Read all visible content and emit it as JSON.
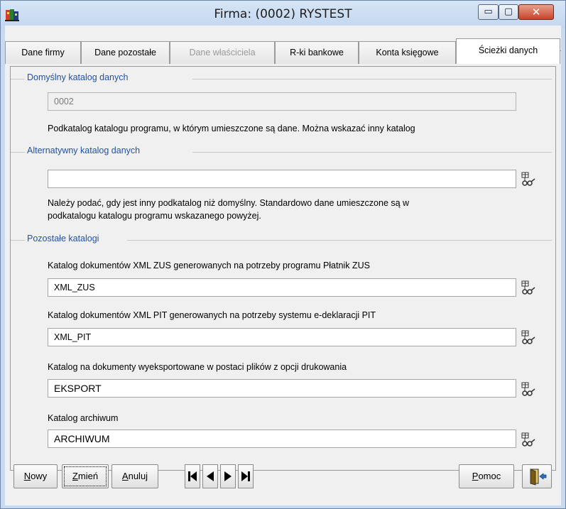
{
  "window": {
    "title": "Firma: (0002) RYSTEST",
    "min_glyph": "▭",
    "max_glyph": "▢",
    "close_glyph": "✕"
  },
  "tabs": [
    {
      "label": "Dane firmy",
      "state": "normal"
    },
    {
      "label": "Dane pozostałe",
      "state": "normal"
    },
    {
      "label": "Dane właściciela",
      "state": "disabled"
    },
    {
      "label": "R-ki bankowe",
      "state": "normal"
    },
    {
      "label": "Konta księgowe",
      "state": "normal"
    },
    {
      "label": "Ścieżki danych",
      "state": "active"
    }
  ],
  "default_catalog": {
    "legend": "Domyślny katalog danych",
    "value": "0002",
    "hint": "Podkatalog katalogu programu, w którym umieszczone są dane. Można wskazać inny katalog"
  },
  "alt_catalog": {
    "legend": "Alternatywny katalog danych",
    "value": "",
    "hint_line1": "Należy podać, gdy jest inny podkatalog niż domyślny. Standardowo dane umieszczone są w",
    "hint_line2": "podkatalogu katalogu programu wskazanego powyżej."
  },
  "other_catalogs": {
    "legend": "Pozostałe katalogi",
    "items": [
      {
        "label": "Katalog dokumentów XML ZUS generowanych na potrzeby programu Płatnik ZUS",
        "value": "XML_ZUS"
      },
      {
        "label": "Katalog dokumentów XML PIT generowanych na potrzeby systemu e-deklaracji PIT",
        "value": "XML_PIT"
      },
      {
        "label": "Katalog na dokumenty wyeksportowane w postaci plików z opcji drukowania",
        "value": "EKSPORT"
      },
      {
        "label": "Katalog archiwum",
        "value": "ARCHIWUM"
      }
    ]
  },
  "toolbar": {
    "new_first": "N",
    "new_rest": "owy",
    "edit_first": "Z",
    "edit_rest": "mień",
    "cancel_first": "A",
    "cancel_rest": "nuluj",
    "help_first": "P",
    "help_rest": "omoc"
  },
  "colors": {
    "legend": "#2152a4",
    "titlebar": "#c9daf0",
    "close": "#c8432b"
  }
}
